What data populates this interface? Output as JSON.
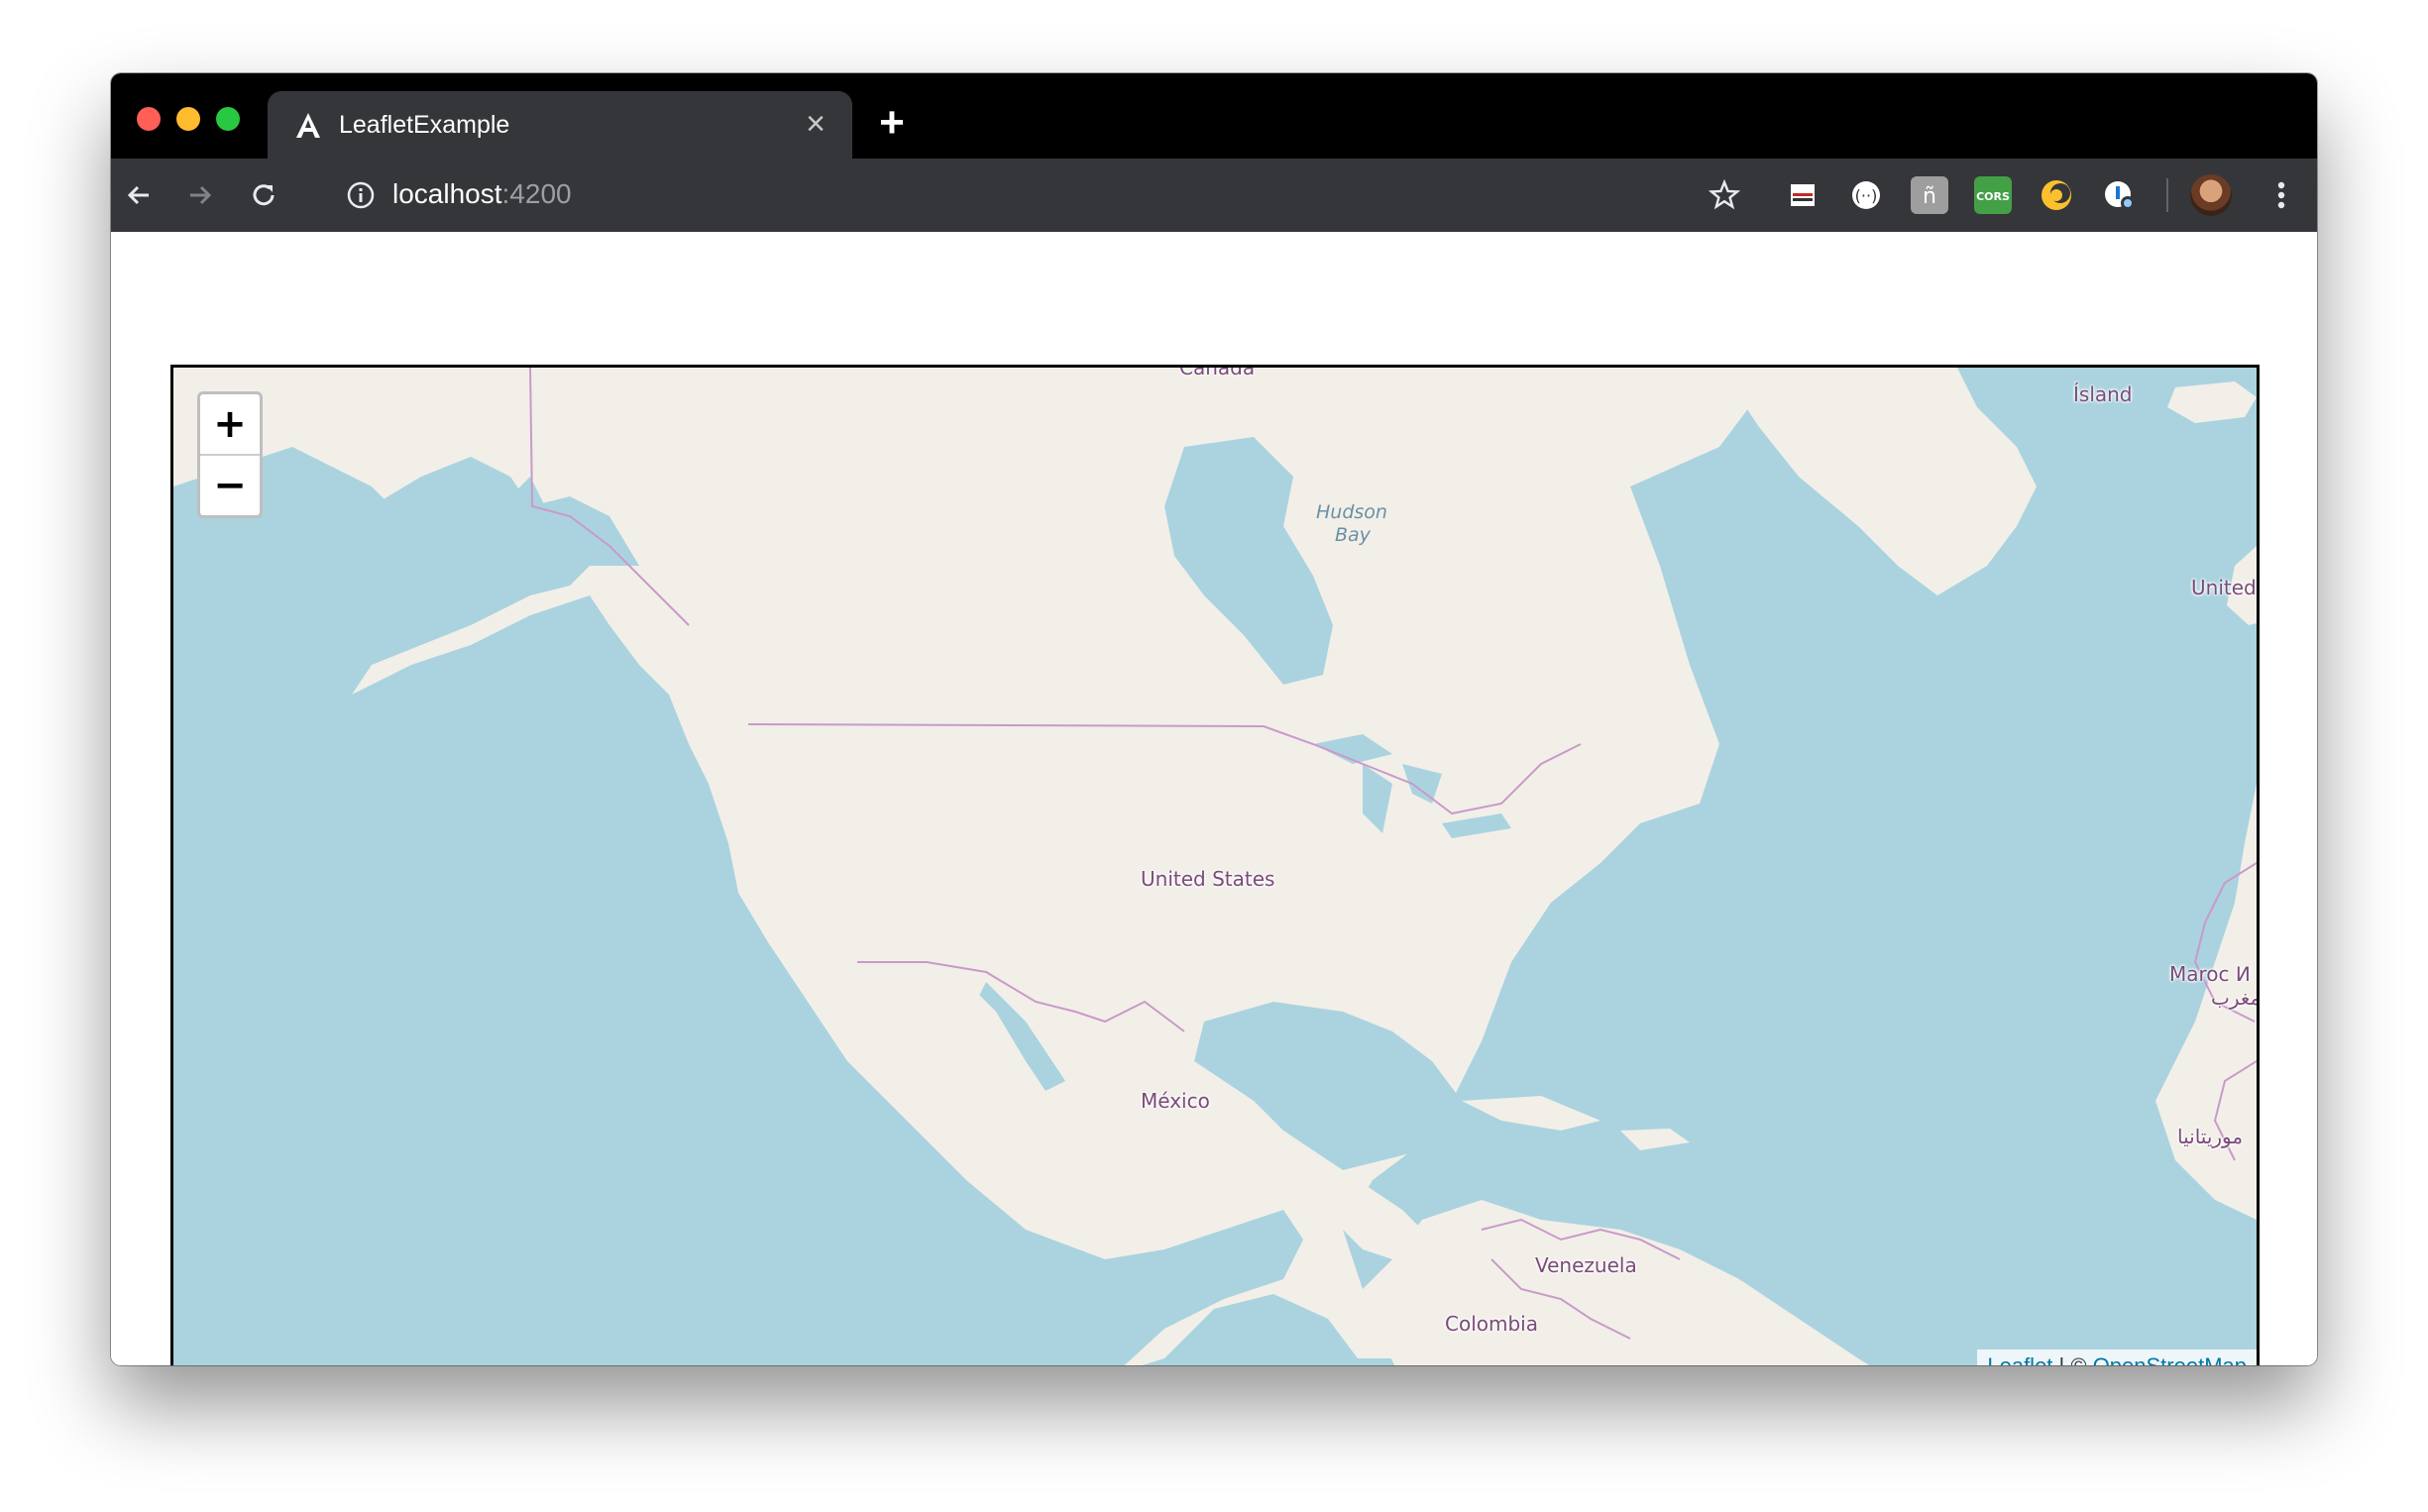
{
  "browser": {
    "tab": {
      "title": "LeafletExample",
      "favicon": "angular-icon",
      "close_icon": "close-icon"
    },
    "new_tab_icon": "plus-icon",
    "toolbar": {
      "back_icon": "back-arrow-icon",
      "forward_icon": "forward-arrow-icon",
      "reload_icon": "reload-icon",
      "info_icon": "info-icon",
      "url_host": "localhost",
      "url_port": ":4200",
      "bookmark_icon": "star-icon",
      "extensions": [
        "extension-icon-1",
        "extension-icon-2",
        "extension-icon-3",
        "cors-extension-icon",
        "extension-icon-5",
        "extension-icon-6"
      ],
      "menu_icon": "more-vert-icon"
    }
  },
  "map": {
    "zoom_in_label": "+",
    "zoom_out_label": "−",
    "labels": {
      "canada": "Canada",
      "hudson_line1": "Hudson",
      "hudson_line2": "Bay",
      "united_states": "United States",
      "mexico": "México",
      "venezuela": "Venezuela",
      "colombia": "Colombia",
      "island": "Ísland",
      "united_kingdom": "United",
      "morocco": "Maroc ⵍ",
      "morocco_ar": "المغرب",
      "mauritania": "موريتانيا"
    },
    "attribution": {
      "leaflet": "Leaflet",
      "separator": " | © ",
      "osm": "OpenStreetMap"
    },
    "colors": {
      "water": "#aad3df",
      "land": "#f2efe9",
      "border": "#c99ac8"
    }
  }
}
